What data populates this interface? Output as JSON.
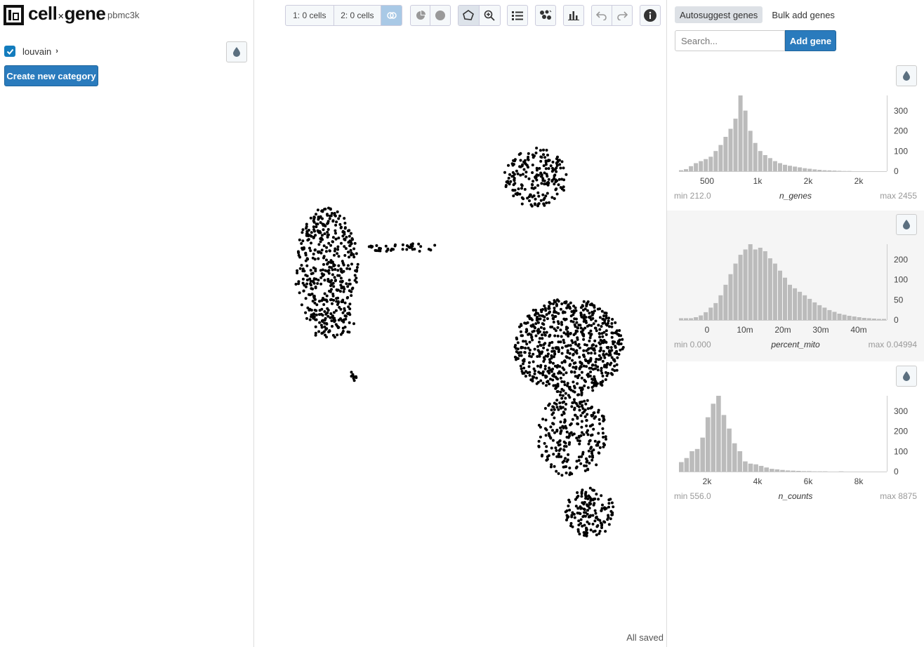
{
  "header": {
    "app_title_left": "cell",
    "app_title_x": "×",
    "app_title_right": "gene",
    "dataset": "pbmc3k"
  },
  "left_panel": {
    "category": {
      "label": "louvain",
      "checked": true
    },
    "create_category_label": "Create new category"
  },
  "toolbar": {
    "cell_set_1": "1: 0 cells",
    "cell_set_2": "2: 0 cells",
    "icons": [
      "venn-icon",
      "pie-icon",
      "circle-icon",
      "lasso-icon",
      "zoom-icon",
      "list-icon",
      "scatter-icon",
      "bar-chart-icon",
      "undo-icon",
      "redo-icon",
      "info-icon"
    ]
  },
  "status": {
    "saved_text": "All saved"
  },
  "right_panel": {
    "tabs": [
      "Autosuggest genes",
      "Bulk add genes"
    ],
    "search_placeholder": "Search...",
    "add_gene_label": "Add gene"
  },
  "histograms": [
    {
      "field": "n_genes",
      "min_label": "min 212.0",
      "max_label": "max 2455",
      "x_ticks": [
        "500",
        "1k",
        "2k",
        "2k"
      ],
      "y_ticks": [
        "300",
        "200",
        "100",
        "0"
      ],
      "bars": [
        5,
        10,
        25,
        40,
        50,
        60,
        72,
        100,
        130,
        170,
        210,
        260,
        375,
        300,
        200,
        140,
        100,
        80,
        65,
        50,
        40,
        32,
        27,
        23,
        19,
        15,
        12,
        9,
        7,
        5,
        4,
        3,
        2,
        1,
        1,
        0,
        0,
        0,
        0,
        0,
        0,
        0
      ]
    },
    {
      "field": "percent_mito",
      "min_label": "min 0.000",
      "max_label": "max 0.04994",
      "x_ticks": [
        "0",
        "10m",
        "20m",
        "30m",
        "40m"
      ],
      "y_ticks": [
        "200",
        "100",
        "50",
        "0"
      ],
      "bars": [
        5,
        5,
        5,
        8,
        13,
        22,
        35,
        48,
        70,
        100,
        130,
        160,
        185,
        200,
        215,
        200,
        205,
        195,
        175,
        160,
        140,
        120,
        100,
        90,
        80,
        70,
        60,
        50,
        42,
        35,
        28,
        23,
        18,
        15,
        12,
        10,
        8,
        6,
        5,
        4,
        3,
        3
      ]
    },
    {
      "field": "n_counts",
      "min_label": "min 556.0",
      "max_label": "max 8875",
      "x_ticks": [
        "2k",
        "4k",
        "6k",
        "8k"
      ],
      "y_ticks": [
        "300",
        "200",
        "100",
        "0"
      ],
      "bars": [
        42,
        60,
        90,
        100,
        150,
        240,
        300,
        335,
        250,
        190,
        125,
        90,
        45,
        35,
        32,
        25,
        18,
        12,
        10,
        7,
        5,
        4,
        3,
        2,
        2,
        1,
        1,
        1,
        0,
        0,
        1,
        0,
        0,
        0,
        0,
        0,
        0,
        0,
        0
      ]
    }
  ],
  "scatter_clusters": [
    {
      "cx": 465,
      "cy": 385,
      "rx": 45,
      "ry": 90,
      "n": 420,
      "shape": "ellipse"
    },
    {
      "cx": 810,
      "cy": 495,
      "rx": 78,
      "ry": 70,
      "n": 700,
      "shape": "ellipse"
    },
    {
      "cx": 815,
      "cy": 620,
      "rx": 50,
      "ry": 60,
      "n": 260,
      "shape": "ellipse"
    },
    {
      "cx": 840,
      "cy": 730,
      "rx": 35,
      "ry": 35,
      "n": 150,
      "shape": "ellipse"
    },
    {
      "cx": 763,
      "cy": 253,
      "rx": 45,
      "ry": 42,
      "n": 200,
      "shape": "ellipse"
    },
    {
      "cx": 470,
      "cy": 460,
      "rx": 35,
      "ry": 22,
      "n": 60,
      "shape": "ellipse"
    },
    {
      "cx": 575,
      "cy": 353,
      "rx": 55,
      "ry": 6,
      "n": 40,
      "shape": "ellipse"
    },
    {
      "cx": 503,
      "cy": 535,
      "rx": 5,
      "ry": 8,
      "n": 8,
      "shape": "ellipse"
    }
  ]
}
